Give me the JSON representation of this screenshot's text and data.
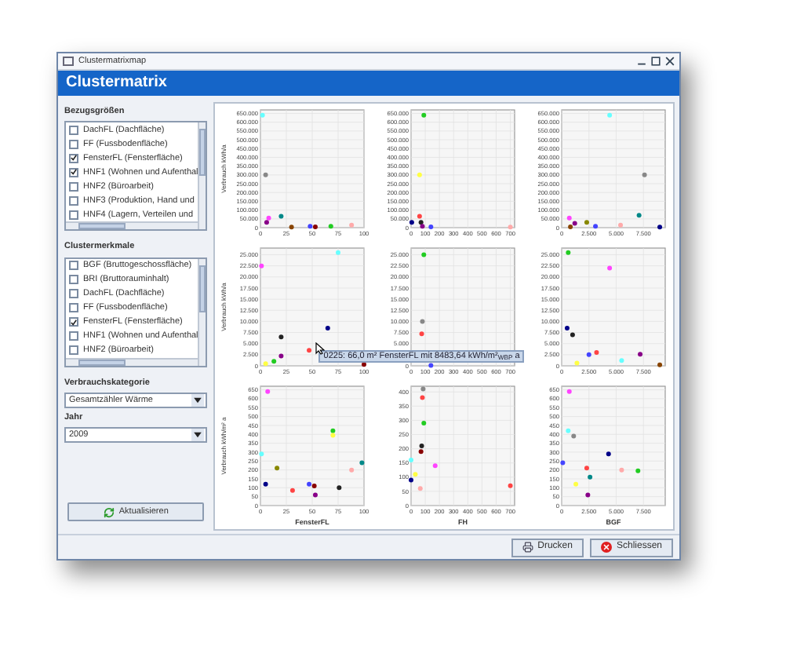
{
  "window": {
    "title": "Clustermatrixmap",
    "header": "Clustermatrix"
  },
  "sidebar": {
    "reference_label": "Bezugsgrößen",
    "reference_items": [
      {
        "label": "DachFL (Dachfläche)",
        "checked": false
      },
      {
        "label": "FF (Fussbodenfläche)",
        "checked": false
      },
      {
        "label": "FensterFL (Fensterfläche)",
        "checked": true
      },
      {
        "label": "HNF1 (Wohnen und Aufenthal",
        "checked": true
      },
      {
        "label": "HNF2 (Büroarbeit)",
        "checked": false
      },
      {
        "label": "HNF3 (Produktion, Hand und",
        "checked": false
      },
      {
        "label": "HNF4 (Lagern, Verteilen und",
        "checked": false
      }
    ],
    "cluster_label": "Clustermerkmale",
    "cluster_items": [
      {
        "label": "BGF (Bruttogeschossfläche)",
        "checked": false
      },
      {
        "label": "BRI (Bruttorauminhalt)",
        "checked": false
      },
      {
        "label": "DachFL (Dachfläche)",
        "checked": false
      },
      {
        "label": "FF (Fussbodenfläche)",
        "checked": false
      },
      {
        "label": "FensterFL (Fensterfläche)",
        "checked": true
      },
      {
        "label": "HNF1 (Wohnen und Aufenthal",
        "checked": false
      },
      {
        "label": "HNF2 (Büroarbeit)",
        "checked": false
      }
    ],
    "category_label": "Verbrauchskategorie",
    "category_value": "Gesamtzähler Wärme",
    "year_label": "Jahr",
    "year_value": "2009",
    "refresh_button": "Aktualisieren"
  },
  "matrix": {
    "charts": [
      {
        "chart_data": {
          "type": "scatter",
          "ylabel": "Verbrauch kWh/a",
          "xlim": [
            0,
            100
          ],
          "ylim": [
            0,
            670000
          ],
          "xticks": [
            0,
            25,
            50,
            75,
            100
          ],
          "yticks": [
            0,
            {
              "value": 50000,
              "label": "50.000"
            },
            {
              "value": 100000,
              "label": "100.000"
            },
            {
              "value": 150000,
              "label": "150.000"
            },
            {
              "value": 200000,
              "label": "200.000"
            },
            {
              "value": 250000,
              "label": "250.000"
            },
            {
              "value": 300000,
              "label": "300.000"
            },
            {
              "value": 350000,
              "label": "350.000"
            },
            {
              "value": 400000,
              "label": "400.000"
            },
            {
              "value": 450000,
              "label": "450.000"
            },
            {
              "value": 500000,
              "label": "500.000"
            },
            {
              "value": 550000,
              "label": "550.000"
            },
            {
              "value": 600000,
              "label": "600.000"
            },
            {
              "value": 650000,
              "label": "650.000"
            }
          ],
          "grid": true,
          "series": [
            {
              "color": "#66ffff",
              "x": [
                2
              ],
              "values": [
                640000
              ]
            },
            {
              "color": "#888888",
              "x": [
                5
              ],
              "values": [
                300000
              ]
            },
            {
              "color": "#ff44ff",
              "x": [
                8
              ],
              "values": [
                55000
              ]
            },
            {
              "color": "#880088",
              "x": [
                6
              ],
              "values": [
                30000
              ]
            },
            {
              "color": "#008888",
              "x": [
                20
              ],
              "values": [
                65000
              ]
            },
            {
              "color": "#4444ff",
              "x": [
                48
              ],
              "values": [
                8000
              ]
            },
            {
              "color": "#880000",
              "x": [
                53
              ],
              "values": [
                5000
              ]
            },
            {
              "color": "#22cc22",
              "x": [
                68
              ],
              "values": [
                8000
              ]
            },
            {
              "color": "#ffaaaa",
              "x": [
                88
              ],
              "values": [
                15000
              ]
            },
            {
              "color": "#884400",
              "x": [
                30
              ],
              "values": [
                3000
              ]
            }
          ]
        }
      },
      {
        "chart_data": {
          "type": "scatter",
          "xlim": [
            0,
            730
          ],
          "ylim": [
            0,
            670000
          ],
          "xticks": [
            0,
            100,
            200,
            300,
            400,
            500,
            600,
            700
          ],
          "yticks": [
            0,
            {
              "value": 50000,
              "label": "50.000"
            },
            {
              "value": 100000,
              "label": "100.000"
            },
            {
              "value": 150000,
              "label": "150.000"
            },
            {
              "value": 200000,
              "label": "200.000"
            },
            {
              "value": 250000,
              "label": "250.000"
            },
            {
              "value": 300000,
              "label": "300.000"
            },
            {
              "value": 350000,
              "label": "350.000"
            },
            {
              "value": 400000,
              "label": "400.000"
            },
            {
              "value": 450000,
              "label": "450.000"
            },
            {
              "value": 500000,
              "label": "500.000"
            },
            {
              "value": 550000,
              "label": "550.000"
            },
            {
              "value": 600000,
              "label": "600.000"
            },
            {
              "value": 650000,
              "label": "650.000"
            }
          ],
          "grid": true,
          "series": [
            {
              "color": "#22cc22",
              "x": [
                90
              ],
              "values": [
                640000
              ]
            },
            {
              "color": "#ffff44",
              "x": [
                60
              ],
              "values": [
                300000
              ]
            },
            {
              "color": "#ff4444",
              "x": [
                60
              ],
              "values": [
                65000
              ]
            },
            {
              "color": "#000088",
              "x": [
                5
              ],
              "values": [
                30000
              ]
            },
            {
              "color": "#222222",
              "x": [
                70
              ],
              "values": [
                30000
              ]
            },
            {
              "color": "#4444ff",
              "x": [
                140
              ],
              "values": [
                5000
              ]
            },
            {
              "color": "#ffaaaa",
              "x": [
                700
              ],
              "values": [
                3000
              ]
            },
            {
              "color": "#880088",
              "x": [
                80
              ],
              "values": [
                8000
              ]
            }
          ]
        }
      },
      {
        "chart_data": {
          "type": "scatter",
          "xlim": [
            0,
            9500
          ],
          "ylim": [
            0,
            670000
          ],
          "xticks": [
            0,
            {
              "value": 2500,
              "label": "2.500"
            },
            {
              "value": 5000,
              "label": "5.000"
            },
            {
              "value": 7500,
              "label": "7.500"
            }
          ],
          "yticks": [
            0,
            {
              "value": 50000,
              "label": "50.000"
            },
            {
              "value": 100000,
              "label": "100.000"
            },
            {
              "value": 150000,
              "label": "150.000"
            },
            {
              "value": 200000,
              "label": "200.000"
            },
            {
              "value": 250000,
              "label": "250.000"
            },
            {
              "value": 300000,
              "label": "300.000"
            },
            {
              "value": 350000,
              "label": "350.000"
            },
            {
              "value": 400000,
              "label": "400.000"
            },
            {
              "value": 450000,
              "label": "450.000"
            },
            {
              "value": 500000,
              "label": "500.000"
            },
            {
              "value": 550000,
              "label": "550.000"
            },
            {
              "value": 600000,
              "label": "600.000"
            },
            {
              "value": 650000,
              "label": "650.000"
            }
          ],
          "grid": true,
          "series": [
            {
              "color": "#66ffff",
              "x": [
                4400
              ],
              "values": [
                640000
              ]
            },
            {
              "color": "#888888",
              "x": [
                7600
              ],
              "values": [
                300000
              ]
            },
            {
              "color": "#ff44ff",
              "x": [
                700
              ],
              "values": [
                55000
              ]
            },
            {
              "color": "#880088",
              "x": [
                1200
              ],
              "values": [
                25000
              ]
            },
            {
              "color": "#008888",
              "x": [
                7100
              ],
              "values": [
                70000
              ]
            },
            {
              "color": "#888800",
              "x": [
                2300
              ],
              "values": [
                30000
              ]
            },
            {
              "color": "#ffaaaa",
              "x": [
                5400
              ],
              "values": [
                15000
              ]
            },
            {
              "color": "#000088",
              "x": [
                9000
              ],
              "values": [
                3000
              ]
            },
            {
              "color": "#4444ff",
              "x": [
                3100
              ],
              "values": [
                8000
              ]
            },
            {
              "color": "#884400",
              "x": [
                800
              ],
              "values": [
                5000
              ]
            }
          ]
        }
      },
      {
        "chart_data": {
          "type": "scatter",
          "ylabel": "Verbrauch kWh/a",
          "xlim": [
            0,
            100
          ],
          "ylim": [
            0,
            26500
          ],
          "xticks": [
            0,
            25,
            50,
            75,
            100
          ],
          "yticks": [
            0,
            {
              "value": 2500,
              "label": "2.500"
            },
            {
              "value": 5000,
              "label": "5.000"
            },
            {
              "value": 7500,
              "label": "7.500"
            },
            {
              "value": 10000,
              "label": "10.000"
            },
            {
              "value": 12500,
              "label": "12.500"
            },
            {
              "value": 15000,
              "label": "15.000"
            },
            {
              "value": 17500,
              "label": "17.500"
            },
            {
              "value": 20000,
              "label": "20.000"
            },
            {
              "value": 22500,
              "label": "22.500"
            },
            {
              "value": 25000,
              "label": "25.000"
            }
          ],
          "grid": true,
          "series": [
            {
              "color": "#ff44ff",
              "x": [
                1
              ],
              "values": [
                22500
              ]
            },
            {
              "color": "#66ffff",
              "x": [
                75
              ],
              "values": [
                25500
              ]
            },
            {
              "color": "#000088",
              "x": [
                65
              ],
              "values": [
                8500
              ]
            },
            {
              "color": "#222222",
              "x": [
                20
              ],
              "values": [
                6500
              ]
            },
            {
              "color": "#ff4444",
              "x": [
                47
              ],
              "values": [
                3500
              ]
            },
            {
              "color": "#880088",
              "x": [
                20
              ],
              "values": [
                2200
              ]
            },
            {
              "color": "#22cc22",
              "x": [
                13
              ],
              "values": [
                1000
              ]
            },
            {
              "color": "#ffff44",
              "x": [
                5
              ],
              "values": [
                500
              ]
            },
            {
              "color": "#880000",
              "x": [
                100
              ],
              "values": [
                300
              ]
            }
          ]
        }
      },
      {
        "chart_data": {
          "type": "scatter",
          "xlim": [
            0,
            730
          ],
          "ylim": [
            0,
            26500
          ],
          "xticks": [
            0,
            100,
            200,
            300,
            400,
            500,
            600,
            700
          ],
          "yticks": [
            0,
            {
              "value": 5000,
              "label": "5.000"
            },
            {
              "value": 7500,
              "label": "7.500"
            },
            {
              "value": 10000,
              "label": "10.000"
            },
            {
              "value": 12500,
              "label": "12.500"
            },
            {
              "value": 15000,
              "label": "15.000"
            },
            {
              "value": 17500,
              "label": "17.500"
            },
            {
              "value": 20000,
              "label": "20.000"
            },
            {
              "value": 22500,
              "label": "22.500"
            },
            {
              "value": 25000,
              "label": "25.000"
            }
          ],
          "grid": true,
          "series": [
            {
              "color": "#22cc22",
              "x": [
                90
              ],
              "values": [
                25000
              ]
            },
            {
              "color": "#888888",
              "x": [
                80
              ],
              "values": [
                10000
              ]
            },
            {
              "color": "#ff4444",
              "x": [
                75
              ],
              "values": [
                7200
              ]
            },
            {
              "color": "#4444ff",
              "x": [
                140
              ],
              "values": [
                100
              ]
            }
          ]
        }
      },
      {
        "chart_data": {
          "type": "scatter",
          "xlim": [
            0,
            9500
          ],
          "ylim": [
            0,
            26500
          ],
          "xticks": [
            0,
            {
              "value": 2500,
              "label": "2.500"
            },
            {
              "value": 5000,
              "label": "5.000"
            },
            {
              "value": 7500,
              "label": "7.500"
            }
          ],
          "yticks": [
            0,
            {
              "value": 2500,
              "label": "2.500"
            },
            {
              "value": 5000,
              "label": "5.000"
            },
            {
              "value": 7500,
              "label": "7.500"
            },
            {
              "value": 10000,
              "label": "10.000"
            },
            {
              "value": 12500,
              "label": "12.500"
            },
            {
              "value": 15000,
              "label": "15.000"
            },
            {
              "value": 17500,
              "label": "17.500"
            },
            {
              "value": 20000,
              "label": "20.000"
            },
            {
              "value": 22500,
              "label": "22.500"
            },
            {
              "value": 25000,
              "label": "25.000"
            }
          ],
          "grid": true,
          "series": [
            {
              "color": "#22cc22",
              "x": [
                600
              ],
              "values": [
                25500
              ]
            },
            {
              "color": "#ff44ff",
              "x": [
                4400
              ],
              "values": [
                22000
              ]
            },
            {
              "color": "#000088",
              "x": [
                500
              ],
              "values": [
                8500
              ]
            },
            {
              "color": "#222222",
              "x": [
                1000
              ],
              "values": [
                7000
              ]
            },
            {
              "color": "#4444ff",
              "x": [
                2500
              ],
              "values": [
                2500
              ]
            },
            {
              "color": "#ff4444",
              "x": [
                3200
              ],
              "values": [
                3000
              ]
            },
            {
              "color": "#66ffff",
              "x": [
                5500
              ],
              "values": [
                1200
              ]
            },
            {
              "color": "#880088",
              "x": [
                7200
              ],
              "values": [
                2600
              ]
            },
            {
              "color": "#884400",
              "x": [
                9000
              ],
              "values": [
                200
              ]
            },
            {
              "color": "#ffff44",
              "x": [
                1400
              ],
              "values": [
                600
              ]
            }
          ]
        }
      },
      {
        "chart_data": {
          "type": "scatter",
          "ylabel": "Verbrauch kWh/m² a",
          "xlabel": "FensterFL",
          "xlim": [
            0,
            100
          ],
          "ylim": [
            0,
            670
          ],
          "xticks": [
            0,
            25,
            50,
            75,
            100
          ],
          "yticks": [
            0,
            50,
            100,
            150,
            200,
            250,
            300,
            350,
            400,
            450,
            500,
            550,
            600,
            650
          ],
          "grid": true,
          "series": [
            {
              "color": "#ff44ff",
              "x": [
                7
              ],
              "values": [
                640
              ]
            },
            {
              "color": "#22cc22",
              "x": [
                70
              ],
              "values": [
                420
              ]
            },
            {
              "color": "#ffff44",
              "x": [
                70
              ],
              "values": [
                395
              ]
            },
            {
              "color": "#66ffff",
              "x": [
                1
              ],
              "values": [
                290
              ]
            },
            {
              "color": "#008888",
              "x": [
                98
              ],
              "values": [
                240
              ]
            },
            {
              "color": "#ffaaaa",
              "x": [
                88
              ],
              "values": [
                200
              ]
            },
            {
              "color": "#888800",
              "x": [
                16
              ],
              "values": [
                210
              ]
            },
            {
              "color": "#000088",
              "x": [
                5
              ],
              "values": [
                120
              ]
            },
            {
              "color": "#4444ff",
              "x": [
                47
              ],
              "values": [
                120
              ]
            },
            {
              "color": "#880000",
              "x": [
                52
              ],
              "values": [
                110
              ]
            },
            {
              "color": "#222222",
              "x": [
                76
              ],
              "values": [
                100
              ]
            },
            {
              "color": "#880088",
              "x": [
                53
              ],
              "values": [
                60
              ]
            },
            {
              "color": "#ff4444",
              "x": [
                31
              ],
              "values": [
                85
              ]
            }
          ]
        }
      },
      {
        "chart_data": {
          "type": "scatter",
          "xlabel": "FH",
          "xlim": [
            0,
            730
          ],
          "ylim": [
            0,
            420
          ],
          "xticks": [
            0,
            100,
            200,
            300,
            400,
            500,
            600,
            700
          ],
          "yticks": [
            0,
            50,
            100,
            150,
            200,
            250,
            300,
            350,
            400
          ],
          "grid": true,
          "series": [
            {
              "color": "#888888",
              "x": [
                85
              ],
              "values": [
                410
              ]
            },
            {
              "color": "#ff4444",
              "x": [
                80
              ],
              "values": [
                380
              ]
            },
            {
              "color": "#22cc22",
              "x": [
                90
              ],
              "values": [
                290
              ]
            },
            {
              "color": "#222222",
              "x": [
                75
              ],
              "values": [
                210
              ]
            },
            {
              "color": "#880000",
              "x": [
                70
              ],
              "values": [
                190
              ]
            },
            {
              "color": "#ff44ff",
              "x": [
                170
              ],
              "values": [
                140
              ]
            },
            {
              "color": "#ffff44",
              "x": [
                30
              ],
              "values": [
                110
              ]
            },
            {
              "color": "#000088",
              "x": [
                0
              ],
              "values": [
                90
              ]
            },
            {
              "color": "#ffaaaa",
              "x": [
                65
              ],
              "values": [
                60
              ]
            },
            {
              "color": "#66ffff",
              "x": [
                0
              ],
              "values": [
                160
              ]
            },
            {
              "color": "#ff4444",
              "x": [
                700
              ],
              "values": [
                70
              ]
            }
          ]
        }
      },
      {
        "chart_data": {
          "type": "scatter",
          "xlabel": "BGF",
          "xlim": [
            0,
            9500
          ],
          "ylim": [
            0,
            670
          ],
          "xticks": [
            0,
            {
              "value": 2500,
              "label": "2.500"
            },
            {
              "value": 5000,
              "label": "5.000"
            },
            {
              "value": 7500,
              "label": "7.500"
            }
          ],
          "yticks": [
            0,
            50,
            100,
            150,
            200,
            250,
            300,
            350,
            400,
            450,
            500,
            550,
            600,
            650
          ],
          "grid": true,
          "series": [
            {
              "color": "#ff44ff",
              "x": [
                700
              ],
              "values": [
                640
              ]
            },
            {
              "color": "#66ffff",
              "x": [
                600
              ],
              "values": [
                420
              ]
            },
            {
              "color": "#888888",
              "x": [
                1100
              ],
              "values": [
                390
              ]
            },
            {
              "color": "#000088",
              "x": [
                4300
              ],
              "values": [
                290
              ]
            },
            {
              "color": "#ffaaaa",
              "x": [
                5500
              ],
              "values": [
                200
              ]
            },
            {
              "color": "#22cc22",
              "x": [
                7000
              ],
              "values": [
                195
              ]
            },
            {
              "color": "#ff4444",
              "x": [
                2300
              ],
              "values": [
                210
              ]
            },
            {
              "color": "#008888",
              "x": [
                2600
              ],
              "values": [
                160
              ]
            },
            {
              "color": "#4444ff",
              "x": [
                100
              ],
              "values": [
                240
              ]
            },
            {
              "color": "#ffff44",
              "x": [
                1300
              ],
              "values": [
                120
              ]
            },
            {
              "color": "#880088",
              "x": [
                2400
              ],
              "values": [
                60
              ]
            }
          ]
        }
      }
    ],
    "tooltip": "0225: 66,0 m² FensterFL mit 8483,64 kWh/m²$_{WBP}$ a"
  },
  "buttons": {
    "print": "Drucken",
    "close": "Schliessen"
  }
}
